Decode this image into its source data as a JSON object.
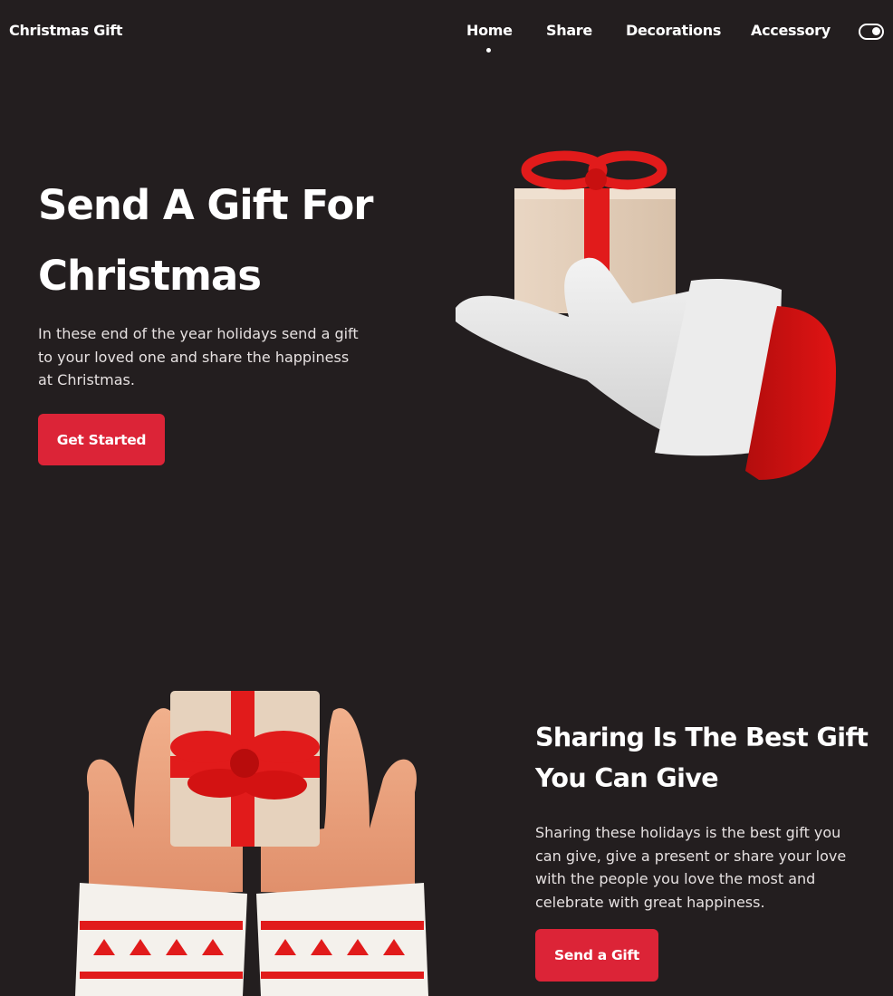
{
  "header": {
    "logo": "Christmas Gift",
    "nav": {
      "home": "Home",
      "share": "Share",
      "decorations": "Decorations",
      "accessory": "Accessory"
    }
  },
  "hero": {
    "title_line1": "Send A Gift For",
    "title_line2": "Christmas",
    "description": "In these end of the year holidays send a gift to your loved one and share the happiness at Christmas.",
    "button": "Get Started"
  },
  "share": {
    "title_line1": "Sharing Is The Best Gift",
    "title_line2": "You Can Give",
    "description": "Sharing these holidays is the best gift you can give, give a present or share your love with the people you love the most and celebrate with great happiness.",
    "button": "Send a Gift"
  },
  "colors": {
    "background": "#231e1f",
    "accent": "#dc2437",
    "text": "#ffffff",
    "body_text": "#e6e1e1"
  }
}
